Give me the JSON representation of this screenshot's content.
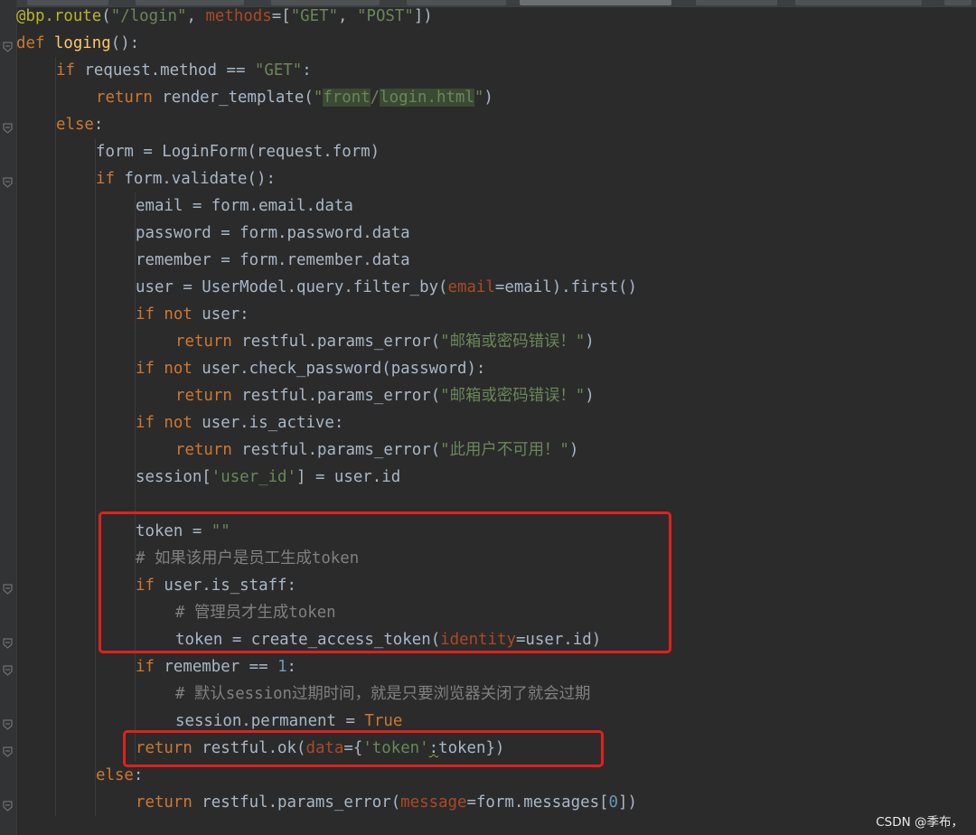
{
  "editor": {
    "language": "python",
    "background": "#2b2b2b",
    "lines": [
      {
        "indent": 0,
        "tokens": [
          [
            "deco",
            "@bp.route"
          ],
          [
            "plain",
            "("
          ],
          [
            "str",
            "\"/login\""
          ],
          [
            "plain",
            ", "
          ],
          [
            "param",
            "methods"
          ],
          [
            "plain",
            "=["
          ],
          [
            "str",
            "\"GET\""
          ],
          [
            "plain",
            ", "
          ],
          [
            "str",
            "\"POST\""
          ],
          [
            "plain",
            "])"
          ]
        ]
      },
      {
        "indent": 0,
        "tokens": [
          [
            "kw",
            "def "
          ],
          [
            "fn",
            "loging"
          ],
          [
            "plain",
            "():"
          ]
        ]
      },
      {
        "indent": 1,
        "tokens": [
          [
            "kw",
            "if "
          ],
          [
            "plain",
            "request.method == "
          ],
          [
            "str",
            "\"GET\""
          ],
          [
            "plain",
            ":"
          ]
        ]
      },
      {
        "indent": 2,
        "tokens": [
          [
            "kw",
            "return "
          ],
          [
            "plain",
            "render_template("
          ],
          [
            "str",
            "\""
          ],
          [
            "strhl",
            "front"
          ],
          [
            "str",
            "/"
          ],
          [
            "strhl",
            "login.html"
          ],
          [
            "str",
            "\""
          ],
          [
            "plain",
            ")"
          ]
        ]
      },
      {
        "indent": 1,
        "tokens": [
          [
            "kw",
            "else"
          ],
          [
            "plain",
            ":"
          ]
        ]
      },
      {
        "indent": 2,
        "tokens": [
          [
            "plain",
            "form = LoginForm(request.form)"
          ]
        ]
      },
      {
        "indent": 2,
        "tokens": [
          [
            "kw",
            "if "
          ],
          [
            "plain",
            "form.validate():"
          ]
        ]
      },
      {
        "indent": 3,
        "tokens": [
          [
            "plain",
            "email = form.email.data"
          ]
        ]
      },
      {
        "indent": 3,
        "tokens": [
          [
            "plain",
            "password = form.password.data"
          ]
        ]
      },
      {
        "indent": 3,
        "tokens": [
          [
            "plain",
            "remember = form.remember.data"
          ]
        ]
      },
      {
        "indent": 3,
        "tokens": [
          [
            "plain",
            "user = UserModel.query.filter_by("
          ],
          [
            "param",
            "email"
          ],
          [
            "plain",
            "=email).first()"
          ]
        ]
      },
      {
        "indent": 3,
        "tokens": [
          [
            "kw",
            "if not "
          ],
          [
            "plain",
            "user:"
          ]
        ]
      },
      {
        "indent": 4,
        "tokens": [
          [
            "kw",
            "return "
          ],
          [
            "plain",
            "restful.params_error("
          ],
          [
            "str",
            "\"邮箱或密码错误！\""
          ],
          [
            "plain",
            ")"
          ]
        ]
      },
      {
        "indent": 3,
        "tokens": [
          [
            "kw",
            "if not "
          ],
          [
            "plain",
            "user.check_password(password):"
          ]
        ]
      },
      {
        "indent": 4,
        "tokens": [
          [
            "kw",
            "return "
          ],
          [
            "plain",
            "restful.params_error("
          ],
          [
            "str",
            "\"邮箱或密码错误！\""
          ],
          [
            "plain",
            ")"
          ]
        ]
      },
      {
        "indent": 3,
        "tokens": [
          [
            "kw",
            "if not "
          ],
          [
            "plain",
            "user.is_active:"
          ]
        ]
      },
      {
        "indent": 4,
        "tokens": [
          [
            "kw",
            "return "
          ],
          [
            "plain",
            "restful.params_error("
          ],
          [
            "str",
            "\"此用户不可用！\""
          ],
          [
            "plain",
            ")"
          ]
        ]
      },
      {
        "indent": 3,
        "tokens": [
          [
            "plain",
            "session["
          ],
          [
            "str",
            "'user_id'"
          ],
          [
            "plain",
            "] = user.id"
          ]
        ]
      },
      {
        "indent": 3,
        "tokens": []
      },
      {
        "indent": 3,
        "tokens": [
          [
            "plain",
            "token = "
          ],
          [
            "str",
            "\"\""
          ]
        ]
      },
      {
        "indent": 3,
        "tokens": [
          [
            "cm",
            "# 如果该用户是员工生成token"
          ]
        ]
      },
      {
        "indent": 3,
        "tokens": [
          [
            "kw",
            "if "
          ],
          [
            "plain",
            "user.is_staff:"
          ]
        ]
      },
      {
        "indent": 4,
        "tokens": [
          [
            "cm",
            "# 管理员才生成token"
          ]
        ]
      },
      {
        "indent": 4,
        "tokens": [
          [
            "plain",
            "token = create_access_token("
          ],
          [
            "param",
            "identity"
          ],
          [
            "plain",
            "=user.id)"
          ]
        ]
      },
      {
        "indent": 3,
        "tokens": [
          [
            "kw",
            "if "
          ],
          [
            "plain",
            "remember == "
          ],
          [
            "num",
            "1"
          ],
          [
            "plain",
            ":"
          ]
        ]
      },
      {
        "indent": 4,
        "tokens": [
          [
            "cm",
            "# 默认session过期时间，就是只要浏览器关闭了就会过期"
          ]
        ]
      },
      {
        "indent": 4,
        "tokens": [
          [
            "plain",
            "session.permanent = "
          ],
          [
            "kw",
            "True"
          ]
        ]
      },
      {
        "indent": 3,
        "tokens": [
          [
            "kw",
            "return "
          ],
          [
            "plain",
            "restful.ok("
          ],
          [
            "param",
            "data"
          ],
          [
            "plain",
            "={"
          ],
          [
            "str",
            "'token'"
          ],
          [
            "squig",
            ":"
          ],
          [
            "plain",
            "token})"
          ]
        ]
      },
      {
        "indent": 2,
        "tokens": [
          [
            "kw",
            "else"
          ],
          [
            "plain",
            ":"
          ]
        ]
      },
      {
        "indent": 3,
        "tokens": [
          [
            "kw",
            "return "
          ],
          [
            "plain",
            "restful.params_error("
          ],
          [
            "param",
            "message"
          ],
          [
            "plain",
            "=form.messages["
          ],
          [
            "num",
            "0"
          ],
          [
            "plain",
            "])"
          ]
        ]
      }
    ]
  },
  "watermark": "CSDN @季布，",
  "highlight_color": "#e0211c"
}
